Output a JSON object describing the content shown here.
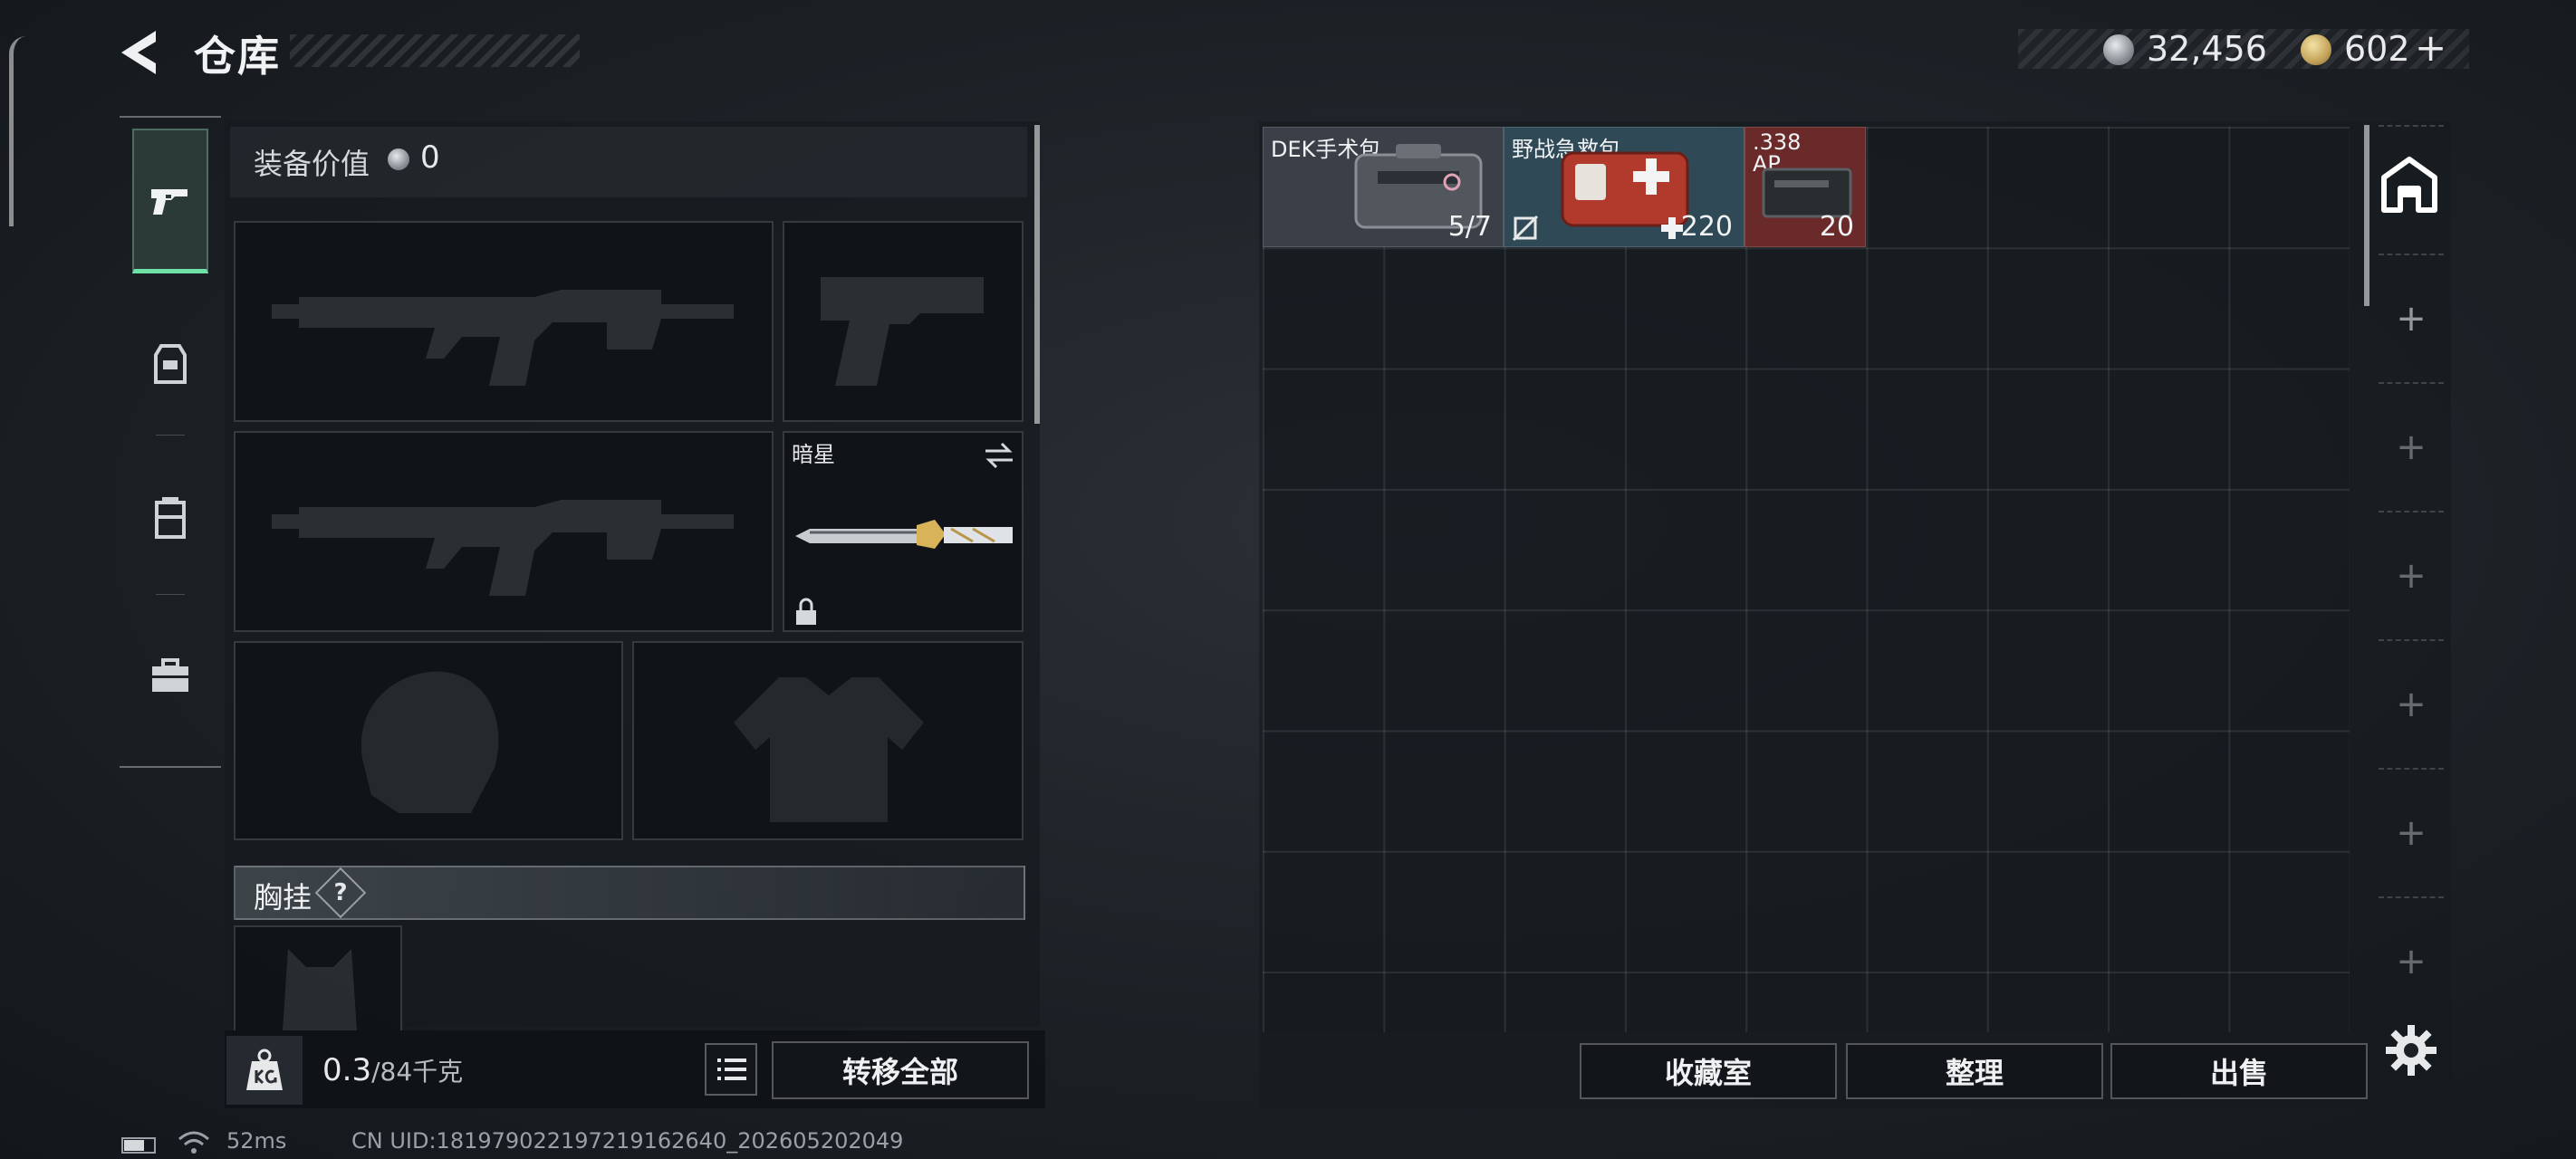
{
  "header": {
    "title": "仓库"
  },
  "currency": {
    "silver": "32,456",
    "gold": "602",
    "gold_add": "+"
  },
  "sidebar": {
    "tabs": [
      "firearm",
      "backpack-armor",
      "chest-rig",
      "case"
    ]
  },
  "equipment": {
    "value_label": "装备价值",
    "value": "0",
    "melee_name": "暗星",
    "chest_rig_label": "胸挂",
    "chest_rig_help": "?"
  },
  "weight": {
    "current": "0.3",
    "capacity": "/84",
    "unit": "千克"
  },
  "buttons": {
    "transfer_all": "转移全部",
    "collection": "收藏室",
    "organize": "整理",
    "sell": "出售"
  },
  "storage_items": [
    {
      "name": "DEK手术包",
      "count": "5/7",
      "color": "#3a3f48"
    },
    {
      "name": "野战急救包",
      "count": "220",
      "color": "#2f4a56"
    },
    {
      "name": ".338\nAP",
      "count": "20",
      "color": "#6a2a2a"
    }
  ],
  "status": {
    "ping": "52ms",
    "uid": "CN UID:18197902219721916264​0_202605202049"
  }
}
